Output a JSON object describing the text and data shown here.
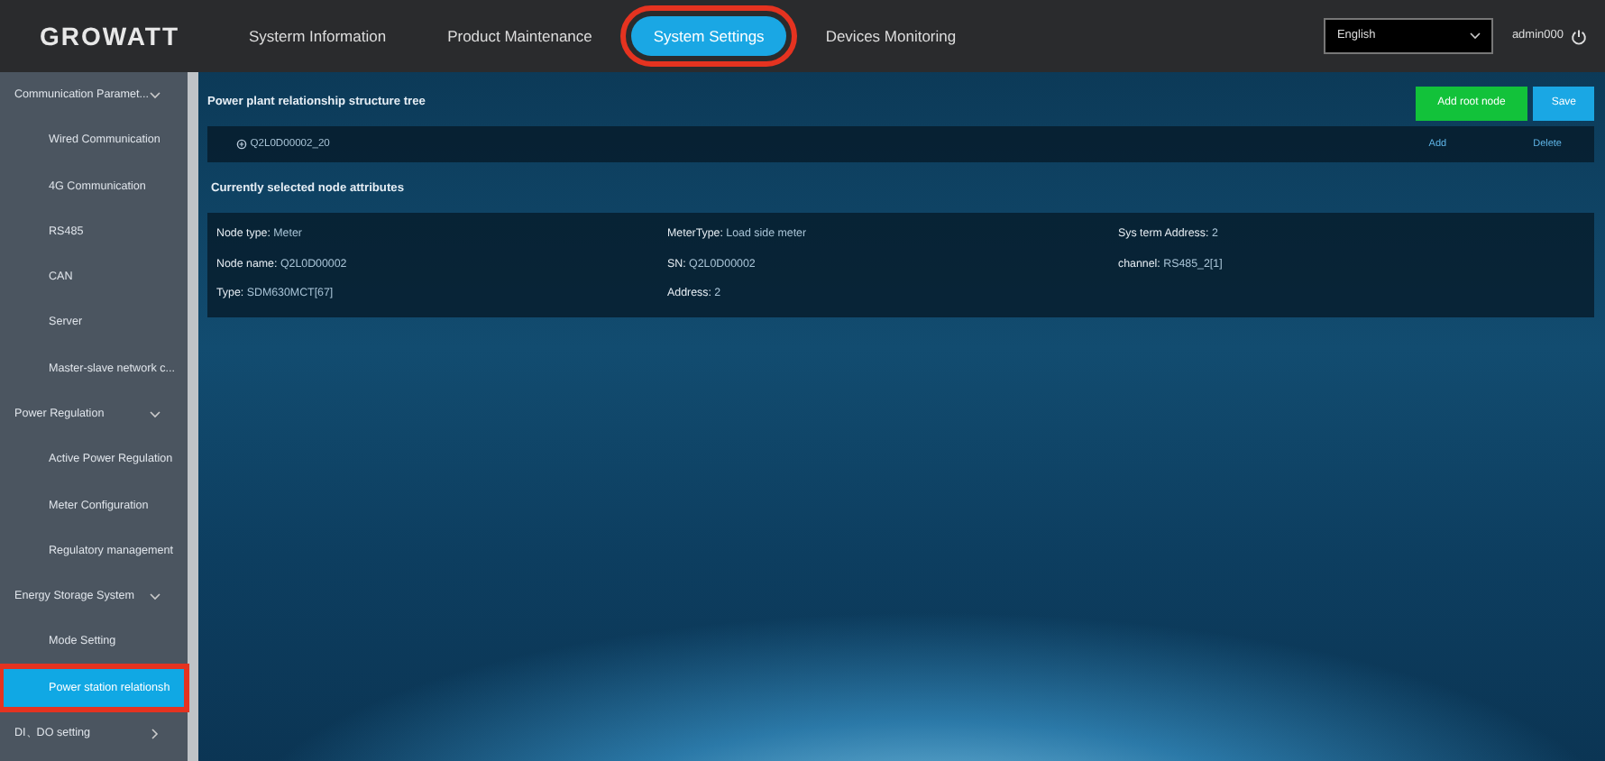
{
  "logo": "GROWATT",
  "nav": [
    {
      "label": "Systerm Information",
      "selected": false,
      "highlighted": false
    },
    {
      "label": "Product Maintenance",
      "selected": false,
      "highlighted": false
    },
    {
      "label": "System Settings",
      "selected": true,
      "highlighted": true
    },
    {
      "label": "Devices Monitoring",
      "selected": false,
      "highlighted": false
    }
  ],
  "language": {
    "value": "English"
  },
  "user": "admin000",
  "sidebar": [
    {
      "label": "Communication Paramet...",
      "expanded": true,
      "children": [
        {
          "label": "Wired Communication",
          "selected": false,
          "highlighted": false
        },
        {
          "label": "4G Communication",
          "selected": false,
          "highlighted": false
        },
        {
          "label": "RS485",
          "selected": false,
          "highlighted": false
        },
        {
          "label": "CAN",
          "selected": false,
          "highlighted": false
        },
        {
          "label": "Server",
          "selected": false,
          "highlighted": false
        },
        {
          "label": "Master-slave network c...",
          "selected": false,
          "highlighted": false
        }
      ]
    },
    {
      "label": "Power Regulation",
      "expanded": true,
      "children": [
        {
          "label": "Active Power Regulation",
          "selected": false,
          "highlighted": false
        },
        {
          "label": "Meter Configuration",
          "selected": false,
          "highlighted": false
        },
        {
          "label": "Regulatory management",
          "selected": false,
          "highlighted": false
        }
      ]
    },
    {
      "label": "Energy Storage System",
      "expanded": true,
      "children": [
        {
          "label": "Mode Setting",
          "selected": false,
          "highlighted": false
        },
        {
          "label": "Power station relationsh",
          "selected": true,
          "highlighted": true
        }
      ]
    },
    {
      "label": "DI、DO setting",
      "expanded": false
    }
  ],
  "tree_title": "Power plant relationship structure tree",
  "buttons": [
    {
      "kind": "add",
      "label": "Add root node"
    },
    {
      "kind": "save",
      "label": "Save"
    }
  ],
  "tree": [
    {
      "label": "Q2L0D00002_20",
      "actions": [
        "Add",
        "Delete"
      ]
    }
  ],
  "attributes_title": "Currently selected node attributes",
  "attributes": [
    {
      "label": "Node type:",
      "value": "Meter"
    },
    {
      "label": "MeterType:",
      "value": "Load side meter"
    },
    {
      "label": "Sys term Address:",
      "value": "2"
    },
    {
      "label": "Node name:",
      "value": "Q2L0D00002"
    },
    {
      "label": "SN:",
      "value": "Q2L0D00002"
    },
    {
      "label": "channel:",
      "value": "RS485_2[1]"
    },
    {
      "label": "Type:",
      "value": "SDM630MCT[67]"
    },
    {
      "label": "Address:",
      "value": "2"
    }
  ]
}
